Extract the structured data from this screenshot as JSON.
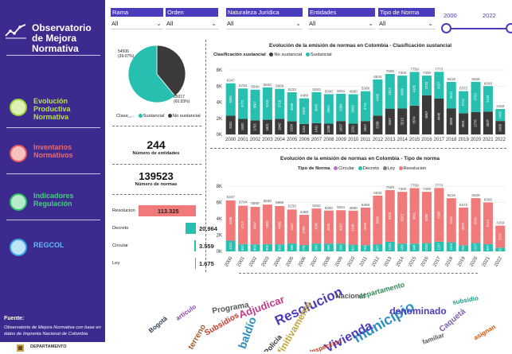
{
  "app": {
    "title": "Observatorio de Mejora Normativa"
  },
  "sidebar": {
    "items": [
      {
        "label": "Evolución Productiva Normativa",
        "icon": "growth-chart-icon",
        "color": "#9bd43a",
        "text_color": "#b9e24b"
      },
      {
        "label": "Inventarios Normativos",
        "icon": "inventory-list-icon",
        "color": "#ea5b5b",
        "text_color": "#ee6b6b"
      },
      {
        "label": "Indicadores Regulación",
        "icon": "indicators-icon",
        "color": "#2ec26b",
        "text_color": "#45d080"
      },
      {
        "label": "REGCOL",
        "icon": "regcol-icon",
        "color": "#39a7e6",
        "text_color": "#5bbef0"
      }
    ],
    "source_heading": "Fuente:",
    "source_text": "Observatorio de Mejora Normativa con base en datos de Imprenta Nacional de Colombia",
    "footer": "DEPARTAMENTO"
  },
  "filters": [
    {
      "label": "Rama",
      "value": "All"
    },
    {
      "label": "Orden",
      "value": "All"
    },
    {
      "label": "Naturaleza Jurídica",
      "value": "All"
    },
    {
      "label": "Entidades",
      "value": "All"
    },
    {
      "label": "Tipo de Norma",
      "value": "All"
    }
  ],
  "year_range": {
    "start": "2000",
    "end": "2022",
    "min": 2000,
    "max": 2022
  },
  "pie": {
    "legend_title": "Clase_...",
    "legend": [
      {
        "name": "Sustancial",
        "color": "#27bfb0"
      },
      {
        "name": "No sustancial",
        "color": "#3a3a3a"
      }
    ],
    "label_nos": "54506",
    "label_nos_pct": "(39.07%)",
    "label_sus": "85017",
    "label_sus_pct": "(60.93%)"
  },
  "kpis": {
    "entities_value": "244",
    "entities_label": "Número de entidades",
    "norms_value": "139523",
    "norms_label": "Número de normas"
  },
  "type_bars": [
    {
      "label": "Resolucion",
      "value": 113325,
      "text": "113.325"
    },
    {
      "label": "Decreto",
      "value": 20964,
      "text": "20.964"
    },
    {
      "label": "Circular",
      "value": 3559,
      "text": "3.559"
    },
    {
      "label": "Ley",
      "value": 1675,
      "text": "1.675"
    }
  ],
  "chart1": {
    "title": "Evolución de la emisión de normas en Colombia - Clasificación sustancial",
    "legend_title": "Clasificación sustancial",
    "legend": [
      {
        "name": "No sustancial",
        "color": "#3a3a3a"
      },
      {
        "name": "Sustancial",
        "color": "#27bfb0"
      }
    ]
  },
  "chart2": {
    "title": "Evolución de la emisión de normas en Colombia - Tipo de norma",
    "legend_title": "Tipo de Norma",
    "legend": [
      {
        "name": "Circular",
        "color": "#b46fcf"
      },
      {
        "name": "Decreto",
        "color": "#27bfb0"
      },
      {
        "name": "Ley",
        "color": "#7a7a7a"
      },
      {
        "name": "Resolucion",
        "color": "#f07a7a"
      }
    ]
  },
  "chart_data": [
    {
      "type": "pie",
      "title": "",
      "categories": [
        "No sustancial",
        "Sustancial"
      ],
      "values": [
        54506,
        85017
      ]
    },
    {
      "type": "bar",
      "title": "",
      "categories": [
        "Resolucion",
        "Decreto",
        "Circular",
        "Ley"
      ],
      "values": [
        113325,
        20964,
        3559,
        1675
      ]
    },
    {
      "type": "bar",
      "stacked": true,
      "title": "Evolución de la emisión de normas en Colombia - Clasificación sustancial",
      "categories": [
        "2000",
        "2001",
        "2002",
        "2003",
        "2004",
        "2005",
        "2006",
        "2007",
        "2008",
        "2009",
        "2010",
        "2011",
        "2012",
        "2013",
        "2014",
        "2015",
        "2016",
        "2017",
        "2018",
        "2019",
        "2020",
        "2021",
        "2022"
      ],
      "totals": [
        6347,
        5704,
        5560,
        5840,
        5660,
        5233,
        4480,
        5253,
        5000,
        5051,
        4990,
        5368,
        6833,
        7509,
        7300,
        7759,
        7300,
        7773,
        6519,
        5372,
        6529,
        6000,
        3159
      ],
      "ylim": [
        0,
        8000
      ],
      "yticks": [
        "0K",
        "2K",
        "4K",
        "6K",
        "8K"
      ],
      "series": [
        {
          "name": "No sustancial",
          "values": [
            2341,
            1932,
            1753,
            1821,
            1942,
            1624,
            1311,
            1411,
            1338,
            1657,
            1331,
            1657,
            2338,
            3197,
            3212,
            3574,
            4867,
            4446,
            3209,
            2631,
            2776,
            2837,
            1666
          ]
        },
        {
          "name": "Sustancial",
          "values": [
            4006,
            3772,
            3807,
            4019,
            3718,
            3609,
            3169,
            3842,
            3662,
            3394,
            3659,
            3711,
            4495,
            4312,
            4088,
            4185,
            2433,
            3327,
            3310,
            2741,
            3753,
            3163,
            1493
          ]
        }
      ],
      "segment_labels": {
        "No sustancial": [
          "2341",
          "1932",
          "1753",
          "1821",
          "1942",
          "1624",
          "1311",
          "1411",
          "1338",
          "1657",
          "1331",
          "1657",
          "2338",
          "3197",
          "3212",
          "3574",
          "4867",
          "4446",
          "3209",
          "2631",
          "2776",
          "2837",
          "1666"
        ],
        "Sustancial": [
          "4006",
          "3772",
          "3807",
          "4019",
          "3718",
          "3609",
          "3169",
          "3842",
          "3662",
          "3394",
          "3659",
          "3711",
          "4495",
          "4312",
          "4088",
          "4185",
          "2433",
          "3327",
          "3310",
          "2741",
          "3753",
          "3163",
          "1493"
        ]
      }
    },
    {
      "type": "bar",
      "stacked": true,
      "title": "Evolución de la emisión de normas en Colombia - Tipo de norma",
      "categories": [
        "2000",
        "2001",
        "2002",
        "2003",
        "2004",
        "2005",
        "2006",
        "2007",
        "2008",
        "2009",
        "2010",
        "2011",
        "2012",
        "2013",
        "2014",
        "2015",
        "2016",
        "2017",
        "2018",
        "2019",
        "2020",
        "2021",
        "2022"
      ],
      "totals": [
        6347,
        5704,
        5560,
        5840,
        5660,
        5233,
        4480,
        5253,
        5000,
        5051,
        4990,
        5368,
        6833,
        7509,
        7300,
        7759,
        7300,
        7773,
        6519,
        5372,
        6529,
        6000,
        3159
      ],
      "ylim": [
        0,
        8000
      ],
      "yticks": [
        "0K",
        "2K",
        "4K",
        "6K",
        "8K"
      ],
      "series": [
        {
          "name": "Decreto",
          "values": [
            1312,
            892,
            863,
            900,
            865,
            966,
            775,
            963,
            950,
            954,
            822,
            763,
            867,
            1184,
            958,
            948,
            1020,
            1187,
            1115,
            750,
            1027,
            887,
            452
          ]
        },
        {
          "name": "Resolucion",
          "values": [
            4935,
            4712,
            4597,
            4840,
            4695,
            4167,
            3705,
            4290,
            4050,
            4097,
            4168,
            4605,
            5966,
            6325,
            6342,
            6811,
            6280,
            6586,
            5404,
            4622,
            5502,
            5113,
            2707
          ]
        }
      ],
      "segment_labels": {
        "Decreto": [
          "1312",
          "892",
          "863",
          "900",
          "865",
          "966",
          "775",
          "963",
          "950",
          "954",
          "822",
          "763",
          "867",
          "1184",
          "958",
          "948",
          "1020",
          "1187",
          "1115",
          "750",
          "1027",
          "887",
          "452"
        ],
        "Resolucion": [
          "4935",
          "4712",
          "4597",
          "4840",
          "4695",
          "4167",
          "3705",
          "4290",
          "4050",
          "4097",
          "4168",
          "4605",
          "5966",
          "6325",
          "6342",
          "6811",
          "6280",
          "6586",
          "5404",
          "4622",
          "5502",
          "5113",
          "2707"
        ]
      }
    }
  ],
  "wordcloud": [
    {
      "text": "Resolucion",
      "color": "#4b3bbd",
      "size": 17
    },
    {
      "text": "municipio",
      "color": "#2a8fbd",
      "size": 18
    },
    {
      "text": "Vivienda",
      "color": "#4b3bbd",
      "size": 16
    },
    {
      "text": "definitivamente",
      "color": "#c0a53a",
      "size": 12
    },
    {
      "text": "Adjudicar",
      "color": "#c23b8c",
      "size": 13
    },
    {
      "text": "baldío",
      "color": "#2a8fbd",
      "size": 14
    },
    {
      "text": "Programa",
      "color": "#555555",
      "size": 10
    },
    {
      "text": "Subsidios",
      "color": "#c0392b",
      "size": 10
    },
    {
      "text": "denominado",
      "color": "#4b3bbd",
      "size": 12
    },
    {
      "text": "Caquetá",
      "color": "#7b5ea7",
      "size": 10
    },
    {
      "text": "terreno",
      "color": "#a05c2c",
      "size": 10
    },
    {
      "text": "Policía",
      "color": "#333333",
      "size": 9
    },
    {
      "text": "Nacional",
      "color": "#555555",
      "size": 9
    },
    {
      "text": "departamento",
      "color": "#2e8b57",
      "size": 9
    },
    {
      "text": "Inspección",
      "color": "#c0392b",
      "size": 8
    },
    {
      "text": "artículo",
      "color": "#8e44ad",
      "size": 8
    },
    {
      "text": "familiar",
      "color": "#555555",
      "size": 8
    },
    {
      "text": "subsidio",
      "color": "#16a085",
      "size": 8
    },
    {
      "text": "asignan",
      "color": "#d35400",
      "size": 8
    },
    {
      "text": "Bogotá",
      "color": "#2c3e50",
      "size": 8
    }
  ]
}
